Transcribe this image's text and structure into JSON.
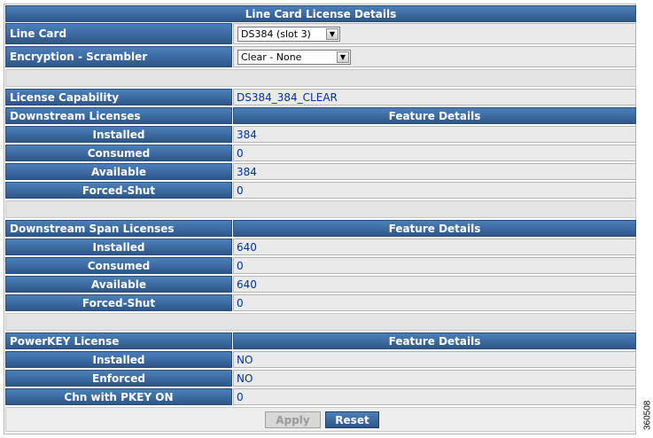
{
  "title": "Line Card License Details",
  "line_card": {
    "label": "Line Card",
    "selected": "DS384 (slot 3)"
  },
  "encryption": {
    "label": "Encryption - Scrambler",
    "selected": "Clear - None"
  },
  "license_capability": {
    "label": "License Capability",
    "value": "DS384_384_CLEAR"
  },
  "downstream": {
    "header": "Downstream Licenses",
    "feature_header": "Feature Details",
    "rows": [
      {
        "label": "Installed",
        "value": "384"
      },
      {
        "label": "Consumed",
        "value": "0"
      },
      {
        "label": "Available",
        "value": "384"
      },
      {
        "label": "Forced-Shut",
        "value": "0"
      }
    ]
  },
  "downstream_span": {
    "header": "Downstream Span Licenses",
    "feature_header": "Feature Details",
    "rows": [
      {
        "label": "Installed",
        "value": "640"
      },
      {
        "label": "Consumed",
        "value": "0"
      },
      {
        "label": "Available",
        "value": "640"
      },
      {
        "label": "Forced-Shut",
        "value": "0"
      }
    ]
  },
  "powerkey": {
    "header": "PowerKEY License",
    "feature_header": "Feature Details",
    "rows": [
      {
        "label": "Installed",
        "value": "NO"
      },
      {
        "label": "Enforced",
        "value": "NO"
      },
      {
        "label": "Chn with PKEY ON",
        "value": "0"
      }
    ]
  },
  "buttons": {
    "apply": "Apply",
    "reset": "Reset"
  },
  "figure_id": "360508"
}
